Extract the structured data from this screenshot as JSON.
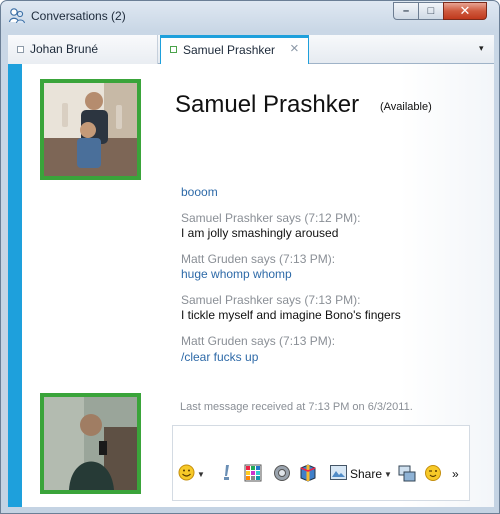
{
  "window": {
    "title": "Conversations (2)",
    "controls": {
      "minimize": "–",
      "maximize": "□",
      "close": "✕"
    }
  },
  "tabs": [
    {
      "label": "Johan Bruné",
      "active": false
    },
    {
      "label": "Samuel Prashker",
      "active": true,
      "close": "×"
    }
  ],
  "tab_menu": "▾",
  "contact": {
    "name": "Samuel Prashker",
    "status": "(Available)"
  },
  "messages": [
    {
      "text": "booom",
      "style": "blue"
    },
    {
      "meta": "Samuel Prashker says (7:12 PM):",
      "text": "I am jolly smashingly aroused",
      "style": "dark"
    },
    {
      "meta": "Matt Gruden says (7:13 PM):",
      "text": "huge whomp whomp",
      "style": "blue"
    },
    {
      "meta": "Samuel Prashker says (7:13 PM):",
      "text": "I tickle myself and imagine Bono's fingers",
      "style": "dark"
    },
    {
      "meta": "Matt Gruden says (7:13 PM):",
      "text": "/clear fucks up",
      "style": "blue"
    }
  ],
  "last_received": "Last message received at 7:13 PM on 6/3/2011.",
  "compose": {
    "value": ""
  },
  "toolbar": {
    "emoticon": "emoticon-icon",
    "nudge": "nudge-icon",
    "wink": "wink-icon",
    "voice": "voice-clip-icon",
    "games": "games-icon",
    "share_label": "Share",
    "video": "video-call-icon",
    "smile": "smiley-icon",
    "more": "»"
  },
  "colors": {
    "accent": "#1ea0dc",
    "avatar_frame": "#3aa43a",
    "link_blue": "#2e6aa8",
    "meta_gray": "#8a8f96"
  }
}
